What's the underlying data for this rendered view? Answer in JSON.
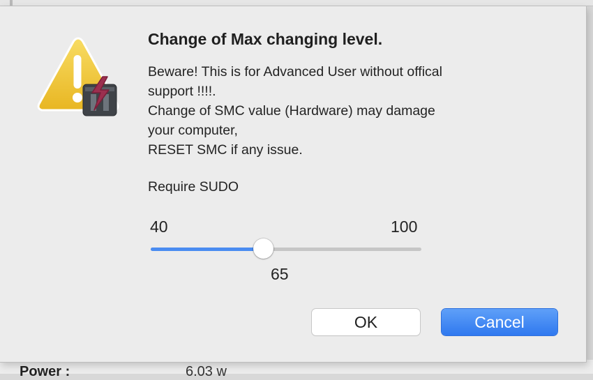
{
  "dialog": {
    "title": "Change of Max changing level.",
    "message_lines": [
      "Beware! This is for Advanced User without offical",
      "support !!!!.",
      "Change of SMC value (Hardware) may damage",
      "your computer,",
      "RESET SMC if any issue."
    ],
    "sudo_note": "Require SUDO",
    "slider": {
      "min_label": "40",
      "max_label": "100",
      "min": 40,
      "max": 100,
      "value": 65,
      "value_label": "65"
    },
    "buttons": {
      "ok_label": "OK",
      "cancel_label": "Cancel"
    },
    "icon": "warning-triangle-icon",
    "badge_icon": "app-badge-icon"
  },
  "background_window": {
    "row_label": "Power :",
    "row_value": "6.03 w"
  },
  "colors": {
    "accent": "#4a8cf1",
    "cancel_button": "#3a82f3",
    "warning_yellow": "#f2cb3a",
    "dialog_bg": "#ececec"
  }
}
